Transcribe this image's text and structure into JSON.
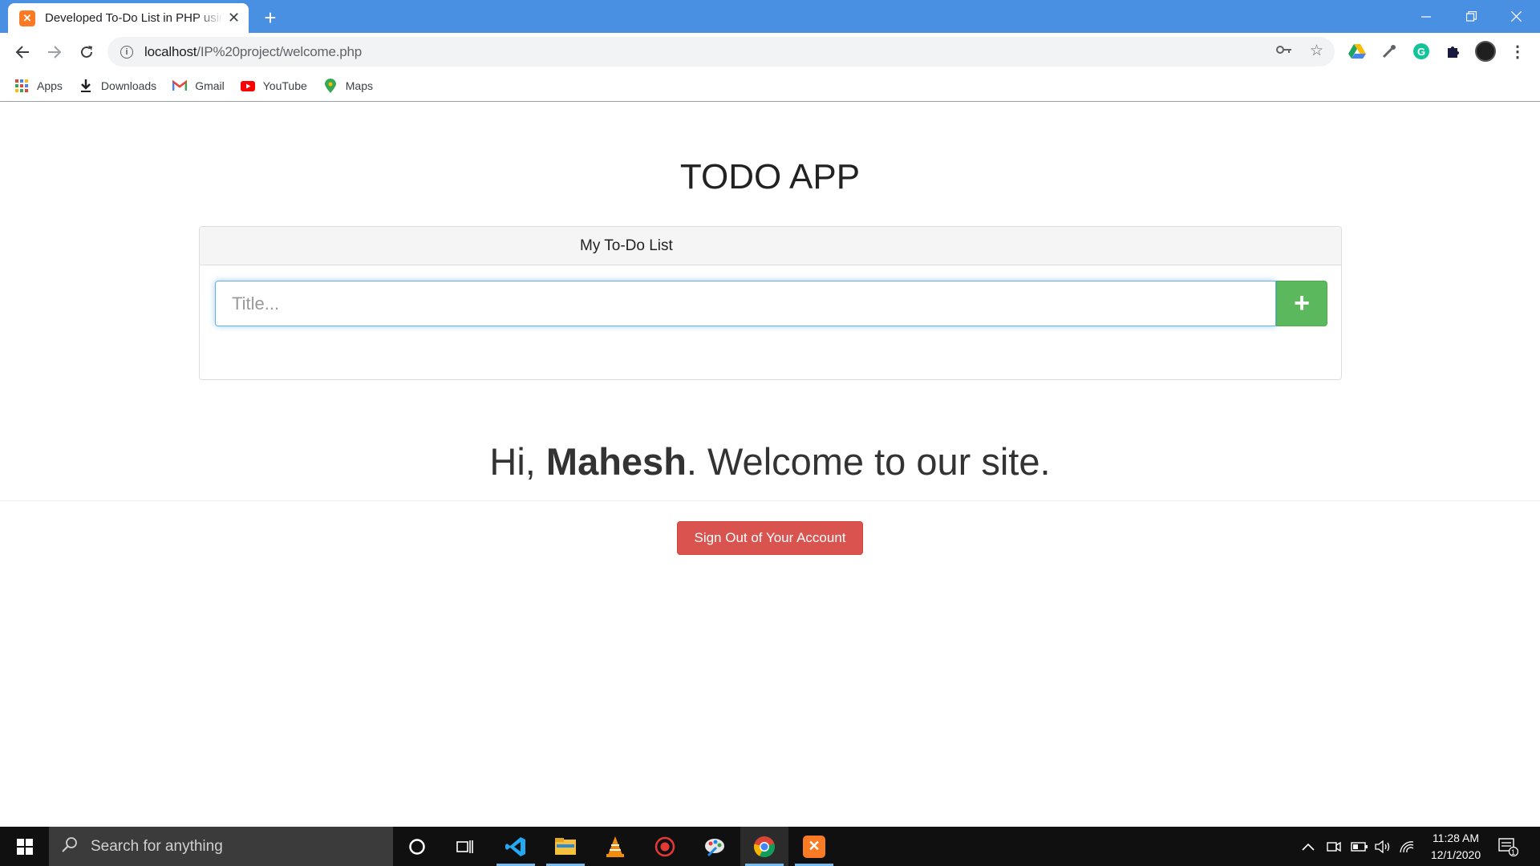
{
  "browser": {
    "tab_title": "Developed To-Do List in PHP using MySQL",
    "tab_favicon": "xampp-icon",
    "new_tab_label": "+",
    "url_host": "localhost",
    "url_path": "/IP%20project/welcome.php",
    "bookmarks": [
      {
        "label": "Apps",
        "icon": "apps-grid-icon"
      },
      {
        "label": "Downloads",
        "icon": "download-icon"
      },
      {
        "label": "Gmail",
        "icon": "gmail-icon"
      },
      {
        "label": "YouTube",
        "icon": "youtube-icon"
      },
      {
        "label": "Maps",
        "icon": "maps-pin-icon"
      }
    ]
  },
  "page": {
    "app_title": "TODO APP",
    "panel_heading": "My To-Do List",
    "title_placeholder": "Title...",
    "add_button_label": "+",
    "welcome_prefix": "Hi, ",
    "username": "Mahesh",
    "welcome_suffix": ". Welcome to our site.",
    "signout_label": "Sign Out of Your Account"
  },
  "colors": {
    "tabstrip": "#4a90e2",
    "add_button": "#5cb85c",
    "signout_button": "#d9534f"
  },
  "taskbar": {
    "search_placeholder": "Search for anything",
    "time": "11:28 AM",
    "date": "12/1/2020",
    "notification_count": "1"
  }
}
